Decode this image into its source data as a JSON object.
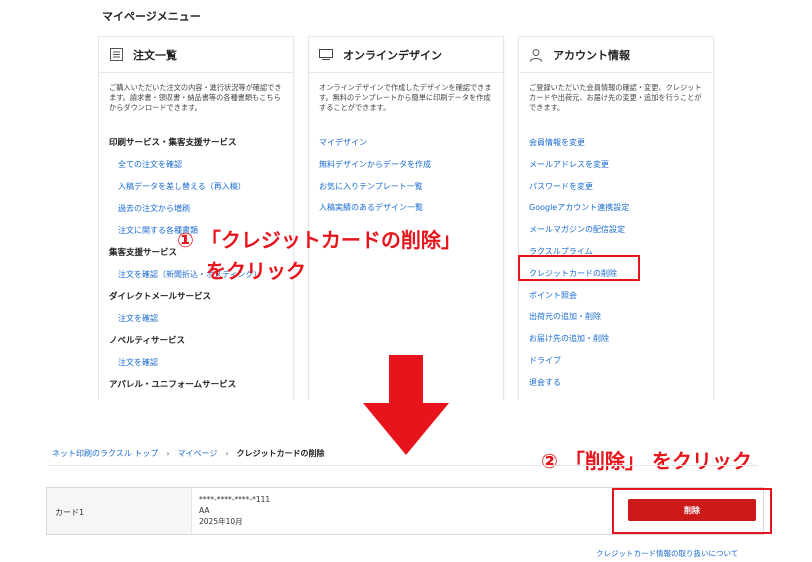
{
  "menu": {
    "heading": "マイページメニュー",
    "orders": {
      "title": "注文一覧",
      "icon": "list-icon",
      "desc": "ご購入いただいた注文の内容・進行状況等が確認できます。請求書・領収書・納品書等の各種書類もこちらからダウンロードできます。",
      "sections": [
        {
          "title": "印刷サービス・集客支援サービス",
          "items": [
            "全ての注文を確認",
            "入稿データを差し替える（再入稿）",
            "過去の注文から増刷",
            "注文に関する各種書類"
          ]
        },
        {
          "title": "集客支援サービス",
          "items": [
            "注文を確認（新聞折込・ポスティング）"
          ]
        },
        {
          "title": "ダイレクトメールサービス",
          "items": [
            "注文を確認"
          ]
        },
        {
          "title": "ノベルティサービス",
          "items": [
            "注文を確認"
          ]
        },
        {
          "title": "アパレル・ユニフォームサービス",
          "items": []
        }
      ]
    },
    "design": {
      "title": "オンラインデザイン",
      "icon": "monitor-icon",
      "desc": "オンラインデザインで作成したデザインを確認できます。無料のテンプレートから簡単に印刷データを作成することができます。",
      "items": [
        "マイデザイン",
        "無料デザインからデータを作成",
        "お気に入りテンプレート一覧",
        "入稿実績のあるデザイン一覧"
      ]
    },
    "account": {
      "title": "アカウント情報",
      "icon": "user-icon",
      "desc": "ご登録いただいた会員情報の確認・変更、クレジットカードや出荷元、お届け先の変更・追加を行うことができます。",
      "items": [
        "会員情報を変更",
        "メールアドレスを変更",
        "パスワードを変更",
        "Googleアカウント連携設定",
        "メールマガジンの配信設定",
        "ラクスルプライム",
        "クレジットカードの削除",
        "ポイント照会",
        "出荷元の追加・削除",
        "お届け先の追加・削除",
        "ドライブ",
        "退会する"
      ]
    }
  },
  "annotations": {
    "step1_line1": "① 「クレジットカードの削除」",
    "step1_line2": "をクリック",
    "step2": "② 「削除」 をクリック"
  },
  "breadcrumb": {
    "home": "ネット印刷のラクスル トップ",
    "sep": "›",
    "mypage": "マイページ",
    "current": "クレジットカードの削除"
  },
  "card": {
    "label": "カード1",
    "number": "****-****-****-*111",
    "holder": "AA",
    "expiry": "2025年10月",
    "delete_label": "削除"
  },
  "footer_link": "クレジットカード情報の取り扱いについて",
  "colors": {
    "accent_red": "#e8141b",
    "button_red": "#cc1a1a",
    "link_blue": "#1a6bd0"
  }
}
